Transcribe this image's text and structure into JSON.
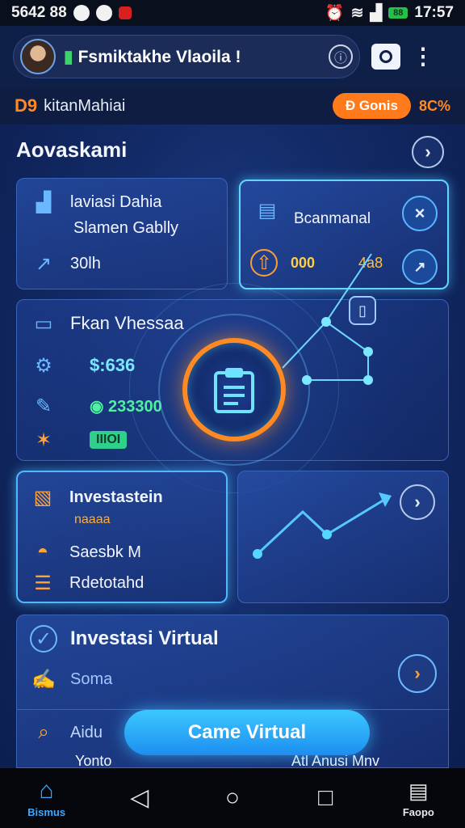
{
  "status_bar": {
    "left_text": "5642 88",
    "time": "17:57",
    "battery": "88"
  },
  "top_bar": {
    "title": "Fsmiktakhe Vlaoila !",
    "info_symbol": "ⓘ"
  },
  "sub_bar": {
    "logo": "D9",
    "name": "kitanMahiai",
    "bonus_label": "Đ Gonis",
    "bonus_pct": "8C%"
  },
  "section": {
    "title": "Aovaskami"
  },
  "card_a": {
    "row1": "laviasi Dahia",
    "row2": "Slamen Gablly",
    "row3": "30lh"
  },
  "card_b": {
    "title": "Bcanmanal",
    "value1": "000",
    "value2": "4a8"
  },
  "card_c": {
    "title": "Fkan Vhessaa",
    "amount": "$:636",
    "stat": "233300",
    "badge": "IIIOI"
  },
  "card_d": {
    "title": "Investastein",
    "subtitle": "naaaa",
    "row2": "Saesbk M",
    "row3": "Rdetotahd"
  },
  "card_f": {
    "title": "Investasi Virtual",
    "row2": "Soma",
    "row3": "Aidu",
    "row4_left": "Yonto",
    "row4_right": "Atl Anusi Mnv"
  },
  "action_button": {
    "label": "Came Virtual"
  },
  "nav": {
    "home_label": "Bismus",
    "menu_label": "Faopo"
  },
  "colors": {
    "accent": "#ff8a24",
    "cyan": "#63d6ff",
    "bg": "#122a66"
  }
}
